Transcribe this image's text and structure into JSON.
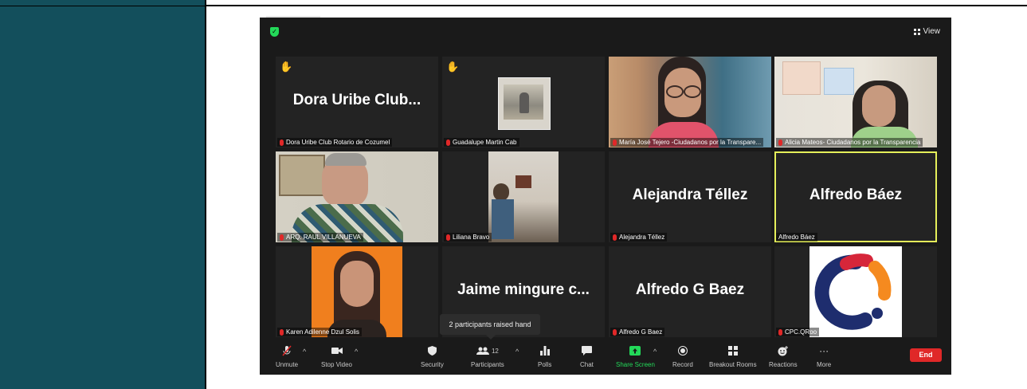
{
  "zoom": {
    "view_label": "View",
    "tiles": [
      {
        "big": "Dora Uribe Club...",
        "label": "Dora Uribe Club Rotario de Cozumel",
        "hand": true
      },
      {
        "big": "",
        "label": "Guadalupe Martin Cab",
        "hand": true
      },
      {
        "big": "",
        "label": "María José Tejero -Ciudadanos por la Transpare..."
      },
      {
        "big": "",
        "label": "Alicia Mateos- Ciudadanos por la Transparencia"
      },
      {
        "big": "",
        "label": "ARQ. RAUL VILLANUEVA"
      },
      {
        "big": "",
        "label": "Liliana Bravo"
      },
      {
        "big": "Alejandra Téllez",
        "label": "Alejandra Téllez"
      },
      {
        "big": "Alfredo Báez",
        "label": "Alfredo Báez",
        "active": true
      },
      {
        "big": "",
        "label": "Karen Adilenne Dzul Solis"
      },
      {
        "big": "Jaime mingure c...",
        "label": ""
      },
      {
        "big": "Alfredo G Baez",
        "label": "Alfredo G Baez"
      },
      {
        "big": "",
        "label": "CPC.QRoo"
      }
    ],
    "tooltip": "2 participants raised hand",
    "toolbar": {
      "unmute": "Unmute",
      "stop_video": "Stop Video",
      "security": "Security",
      "participants": "Participants",
      "participants_count": "12",
      "polls": "Polls",
      "chat": "Chat",
      "share_screen": "Share Screen",
      "record": "Record",
      "breakout_rooms": "Breakout Rooms",
      "reactions": "Reactions",
      "more": "More",
      "end": "End"
    },
    "colors": {
      "background": "#1a1a1a",
      "tile": "#232323",
      "active_border": "#e5ef5a",
      "share_green": "#23d959",
      "end_red": "#e02828",
      "side_panel": "#134f5c"
    }
  }
}
